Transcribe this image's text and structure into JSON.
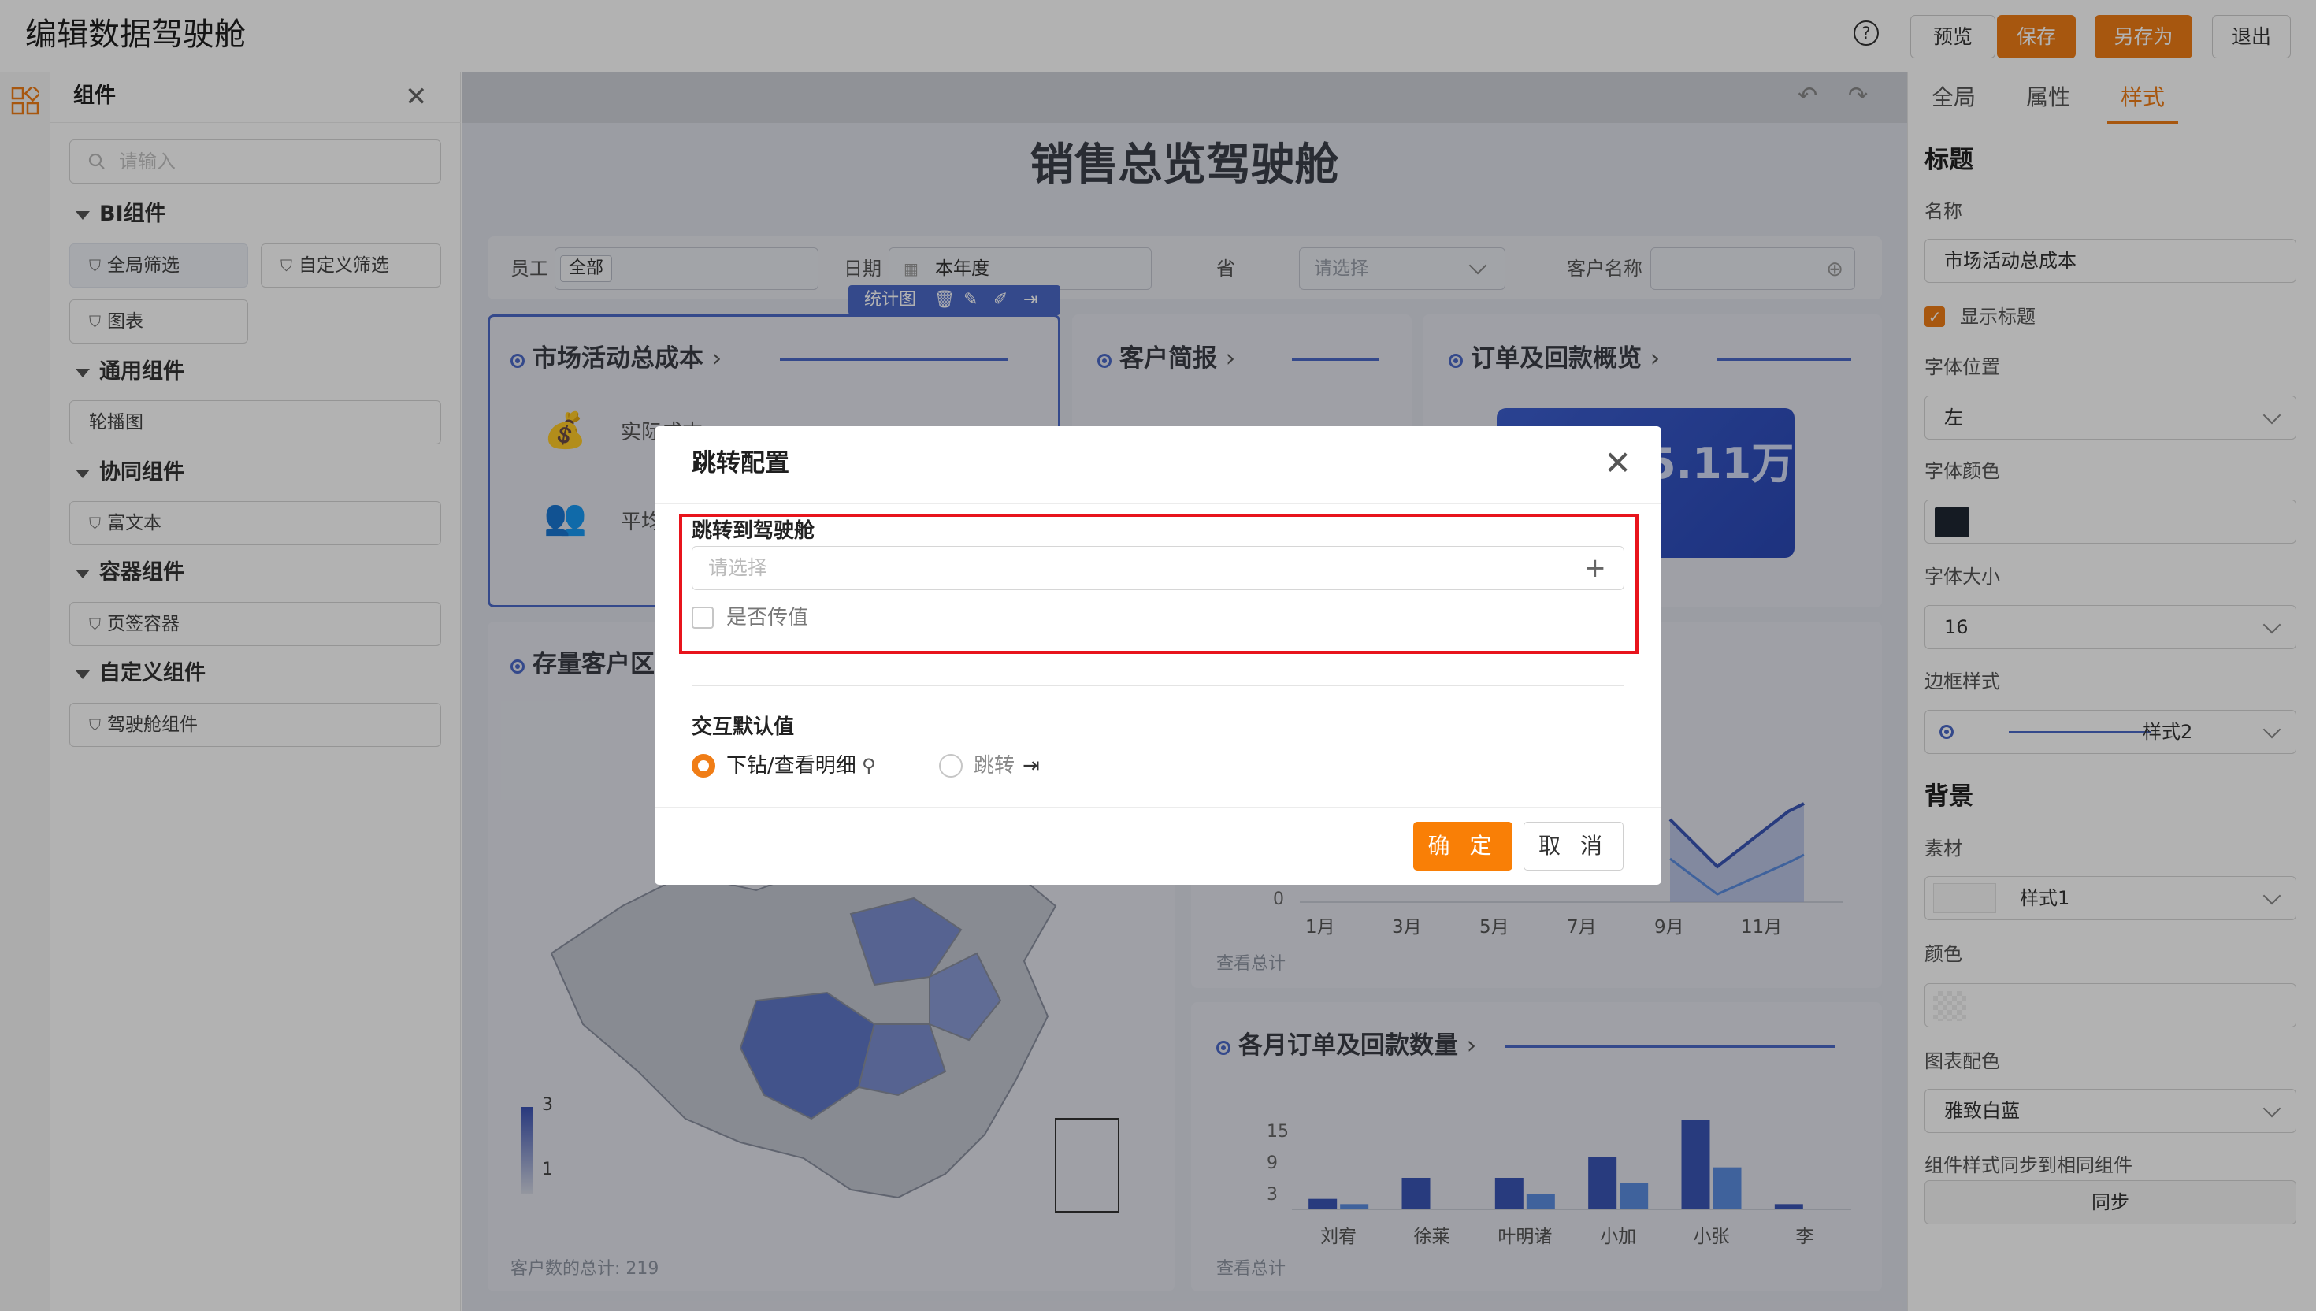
{
  "app": {
    "title": "编辑数据驾驶舱"
  },
  "toolbar": {
    "help": "?",
    "preview": "预览",
    "save": "保存",
    "save_as": "另存为",
    "exit": "退出"
  },
  "components": {
    "title": "组件",
    "search_placeholder": "请输入",
    "sections": [
      {
        "label": "BI组件",
        "items": [
          "全局筛选",
          "自定义筛选",
          "图表"
        ]
      },
      {
        "label": "通用组件",
        "items": [
          "轮播图"
        ]
      },
      {
        "label": "协同组件",
        "items": [
          "富文本"
        ]
      },
      {
        "label": "容器组件",
        "items": [
          "页签容器"
        ]
      },
      {
        "label": "自定义组件",
        "items": [
          "驾驶舱组件"
        ]
      }
    ]
  },
  "dashboard": {
    "title": "销售总览驾驶舱",
    "filters": [
      {
        "label": "员工",
        "value": "全部"
      },
      {
        "label": "日期",
        "value": "本年度"
      },
      {
        "label": "省",
        "value": "请选择"
      },
      {
        "label": "客户名称",
        "value": ""
      }
    ],
    "selection_toolbar": "统计图",
    "cards": {
      "cost": {
        "title": "市场活动总成本",
        "row1": "实际成本",
        "row2": "平均"
      },
      "customer": {
        "title": "客户简报"
      },
      "order": {
        "title": "订单及回款概览",
        "value": "5.11万"
      },
      "region": {
        "title": "存量客户区",
        "legend_max": "3",
        "legend_min": "1",
        "footer": "客户数的总计: 219"
      },
      "trend": {
        "zero": "0",
        "months": [
          "1月",
          "3月",
          "5月",
          "7月",
          "9月",
          "11月"
        ],
        "footer": "查看总计"
      },
      "monthly": {
        "title": "各月订单及回款数量",
        "footer": "查看总计"
      }
    }
  },
  "chart_data": {
    "type": "bar",
    "categories": [
      "刘宥",
      "徐莱",
      "叶明诸",
      "小加",
      "小张",
      "李"
    ],
    "series": [
      {
        "values": [
          2,
          6,
          6,
          10,
          17,
          1
        ]
      },
      {
        "values": [
          1,
          0,
          3,
          5,
          8,
          0
        ]
      }
    ],
    "yticks": [
      "15",
      "9",
      "3"
    ],
    "ylim": [
      0,
      18
    ]
  },
  "right_panel": {
    "tabs": [
      "全局",
      "属性",
      "样式"
    ],
    "active_tab": "样式",
    "title_section": "标题",
    "name_label": "名称",
    "name_value": "市场活动总成本",
    "show_title_label": "显示标题",
    "font_pos_label": "字体位置",
    "font_pos_value": "左",
    "font_color_label": "字体颜色",
    "font_color_value": "#1f2733",
    "font_size_label": "字体大小",
    "font_size_value": "16",
    "border_style_label": "边框样式",
    "border_style_value": "样式2",
    "bg_section": "背景",
    "material_label": "素材",
    "material_value": "样式1",
    "color_label": "颜色",
    "palette_label": "图表配色",
    "palette_value": "雅致白蓝",
    "sync_label": "组件样式同步到相同组件",
    "sync_button": "同步"
  },
  "dialog": {
    "title": "跳转配置",
    "jump_label": "跳转到驾驶舱",
    "jump_placeholder": "请选择",
    "pass_value_label": "是否传值",
    "interaction_label": "交互默认值",
    "option_drill": "下钻/查看明细",
    "option_jump": "跳转",
    "ok": "确 定",
    "cancel": "取 消"
  },
  "colors": {
    "accent": "#f07d16",
    "primary_blue": "#4b69c8",
    "highlight": "#e8141c"
  }
}
